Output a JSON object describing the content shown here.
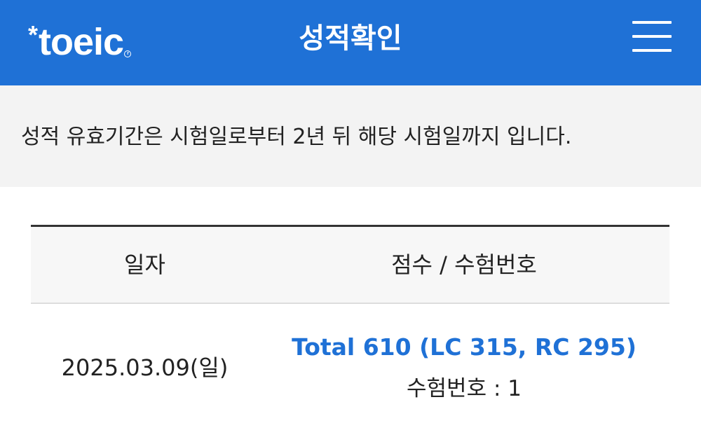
{
  "header": {
    "logo_text": "toeic",
    "logo_star": "*",
    "title": "성적확인",
    "menu_icon": "hamburger-menu-icon",
    "background_color": "#1f71d6"
  },
  "notice": {
    "text": "성적 유효기간은 시험일로부터 2년 뒤 해당 시험일까지 입니다."
  },
  "table": {
    "headers": {
      "date": "일자",
      "score": "점수 / 수험번호"
    },
    "rows": [
      {
        "date": "2025.03.09(일)",
        "score": "Total 610 (LC 315, RC 295)",
        "exam_number": "수험번호 : 1"
      }
    ]
  },
  "colors": {
    "accent": "#1f71d6",
    "notice_bg": "#f3f3f3"
  }
}
